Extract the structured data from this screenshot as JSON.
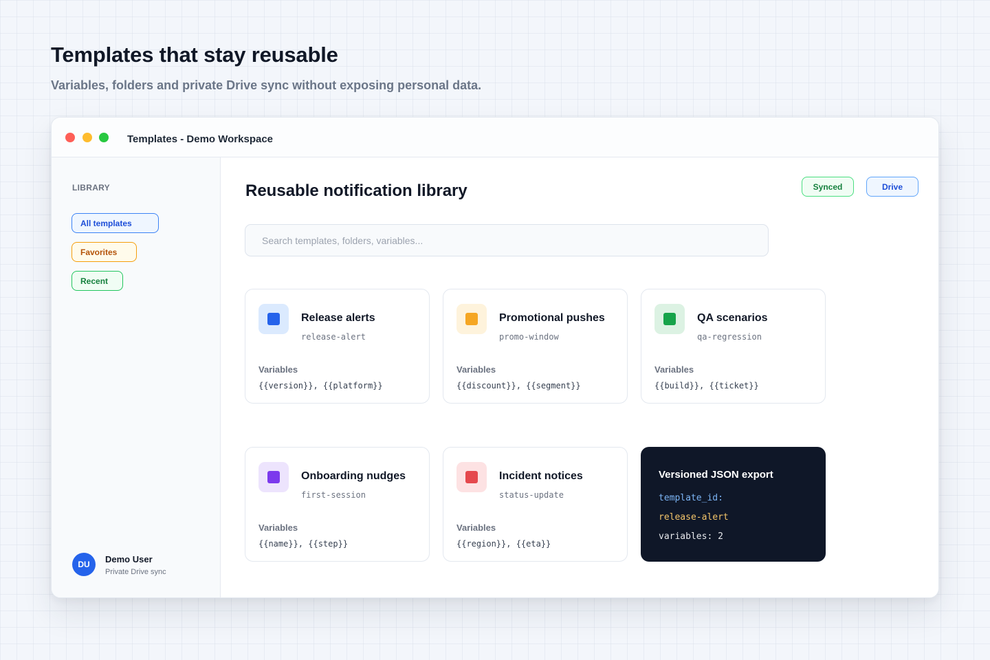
{
  "hero": {
    "title": "Templates that stay reusable",
    "subtitle": "Variables, folders and private Drive sync without exposing personal data."
  },
  "window": {
    "title": "Templates - Demo Workspace"
  },
  "sidebar": {
    "heading": "LIBRARY",
    "items": [
      {
        "label": "All templates",
        "active": true,
        "color": "#3b82f6"
      },
      {
        "label": "Favorites",
        "color": "#f59e0b"
      },
      {
        "label": "Recent",
        "color": "#22c55e"
      }
    ],
    "user": {
      "initials": "DU",
      "name": "Demo User",
      "subtitle": "Private Drive sync"
    }
  },
  "main": {
    "title": "Reusable notification library",
    "badges": {
      "synced": "Synced",
      "drive": "Drive"
    },
    "search": {
      "placeholder": "Search templates, folders, variables...",
      "value": ""
    },
    "variables_label": "Variables",
    "cards": [
      {
        "title": "Release alerts",
        "slug": "release-alert",
        "vars": "{{version}}, {{platform}}",
        "accent": "#2563eb",
        "tint": "#dbeafe"
      },
      {
        "title": "Promotional pushes",
        "slug": "promo-window",
        "vars": "{{discount}}, {{segment}}",
        "accent": "#f5a623",
        "tint": "#fef3dc"
      },
      {
        "title": "QA scenarios",
        "slug": "qa-regression",
        "vars": "{{build}}, {{ticket}}",
        "accent": "#16a34a",
        "tint": "#dcf2e3"
      },
      {
        "title": "Onboarding nudges",
        "slug": "first-session",
        "vars": "{{name}}, {{step}}",
        "accent": "#7c3aed",
        "tint": "#ede4fd"
      },
      {
        "title": "Incident notices",
        "slug": "status-update",
        "vars": "{{region}}, {{eta}}",
        "accent": "#e5484d",
        "tint": "#fde2e3"
      }
    ],
    "export": {
      "title": "Versioned JSON export",
      "key_line": "template_id:",
      "value_line": "release-alert",
      "vars_line": "variables: 2"
    }
  }
}
